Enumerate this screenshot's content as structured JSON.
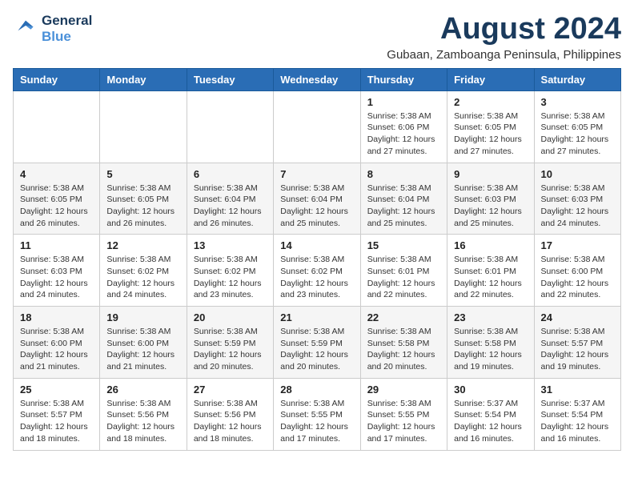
{
  "logo": {
    "line1": "General",
    "line2": "Blue"
  },
  "title": {
    "month_year": "August 2024",
    "location": "Gubaan, Zamboanga Peninsula, Philippines"
  },
  "headers": [
    "Sunday",
    "Monday",
    "Tuesday",
    "Wednesday",
    "Thursday",
    "Friday",
    "Saturday"
  ],
  "weeks": [
    [
      {
        "day": "",
        "info": ""
      },
      {
        "day": "",
        "info": ""
      },
      {
        "day": "",
        "info": ""
      },
      {
        "day": "",
        "info": ""
      },
      {
        "day": "1",
        "info": "Sunrise: 5:38 AM\nSunset: 6:06 PM\nDaylight: 12 hours\nand 27 minutes."
      },
      {
        "day": "2",
        "info": "Sunrise: 5:38 AM\nSunset: 6:05 PM\nDaylight: 12 hours\nand 27 minutes."
      },
      {
        "day": "3",
        "info": "Sunrise: 5:38 AM\nSunset: 6:05 PM\nDaylight: 12 hours\nand 27 minutes."
      }
    ],
    [
      {
        "day": "4",
        "info": "Sunrise: 5:38 AM\nSunset: 6:05 PM\nDaylight: 12 hours\nand 26 minutes."
      },
      {
        "day": "5",
        "info": "Sunrise: 5:38 AM\nSunset: 6:05 PM\nDaylight: 12 hours\nand 26 minutes."
      },
      {
        "day": "6",
        "info": "Sunrise: 5:38 AM\nSunset: 6:04 PM\nDaylight: 12 hours\nand 26 minutes."
      },
      {
        "day": "7",
        "info": "Sunrise: 5:38 AM\nSunset: 6:04 PM\nDaylight: 12 hours\nand 25 minutes."
      },
      {
        "day": "8",
        "info": "Sunrise: 5:38 AM\nSunset: 6:04 PM\nDaylight: 12 hours\nand 25 minutes."
      },
      {
        "day": "9",
        "info": "Sunrise: 5:38 AM\nSunset: 6:03 PM\nDaylight: 12 hours\nand 25 minutes."
      },
      {
        "day": "10",
        "info": "Sunrise: 5:38 AM\nSunset: 6:03 PM\nDaylight: 12 hours\nand 24 minutes."
      }
    ],
    [
      {
        "day": "11",
        "info": "Sunrise: 5:38 AM\nSunset: 6:03 PM\nDaylight: 12 hours\nand 24 minutes."
      },
      {
        "day": "12",
        "info": "Sunrise: 5:38 AM\nSunset: 6:02 PM\nDaylight: 12 hours\nand 24 minutes."
      },
      {
        "day": "13",
        "info": "Sunrise: 5:38 AM\nSunset: 6:02 PM\nDaylight: 12 hours\nand 23 minutes."
      },
      {
        "day": "14",
        "info": "Sunrise: 5:38 AM\nSunset: 6:02 PM\nDaylight: 12 hours\nand 23 minutes."
      },
      {
        "day": "15",
        "info": "Sunrise: 5:38 AM\nSunset: 6:01 PM\nDaylight: 12 hours\nand 22 minutes."
      },
      {
        "day": "16",
        "info": "Sunrise: 5:38 AM\nSunset: 6:01 PM\nDaylight: 12 hours\nand 22 minutes."
      },
      {
        "day": "17",
        "info": "Sunrise: 5:38 AM\nSunset: 6:00 PM\nDaylight: 12 hours\nand 22 minutes."
      }
    ],
    [
      {
        "day": "18",
        "info": "Sunrise: 5:38 AM\nSunset: 6:00 PM\nDaylight: 12 hours\nand 21 minutes."
      },
      {
        "day": "19",
        "info": "Sunrise: 5:38 AM\nSunset: 6:00 PM\nDaylight: 12 hours\nand 21 minutes."
      },
      {
        "day": "20",
        "info": "Sunrise: 5:38 AM\nSunset: 5:59 PM\nDaylight: 12 hours\nand 20 minutes."
      },
      {
        "day": "21",
        "info": "Sunrise: 5:38 AM\nSunset: 5:59 PM\nDaylight: 12 hours\nand 20 minutes."
      },
      {
        "day": "22",
        "info": "Sunrise: 5:38 AM\nSunset: 5:58 PM\nDaylight: 12 hours\nand 20 minutes."
      },
      {
        "day": "23",
        "info": "Sunrise: 5:38 AM\nSunset: 5:58 PM\nDaylight: 12 hours\nand 19 minutes."
      },
      {
        "day": "24",
        "info": "Sunrise: 5:38 AM\nSunset: 5:57 PM\nDaylight: 12 hours\nand 19 minutes."
      }
    ],
    [
      {
        "day": "25",
        "info": "Sunrise: 5:38 AM\nSunset: 5:57 PM\nDaylight: 12 hours\nand 18 minutes."
      },
      {
        "day": "26",
        "info": "Sunrise: 5:38 AM\nSunset: 5:56 PM\nDaylight: 12 hours\nand 18 minutes."
      },
      {
        "day": "27",
        "info": "Sunrise: 5:38 AM\nSunset: 5:56 PM\nDaylight: 12 hours\nand 18 minutes."
      },
      {
        "day": "28",
        "info": "Sunrise: 5:38 AM\nSunset: 5:55 PM\nDaylight: 12 hours\nand 17 minutes."
      },
      {
        "day": "29",
        "info": "Sunrise: 5:38 AM\nSunset: 5:55 PM\nDaylight: 12 hours\nand 17 minutes."
      },
      {
        "day": "30",
        "info": "Sunrise: 5:37 AM\nSunset: 5:54 PM\nDaylight: 12 hours\nand 16 minutes."
      },
      {
        "day": "31",
        "info": "Sunrise: 5:37 AM\nSunset: 5:54 PM\nDaylight: 12 hours\nand 16 minutes."
      }
    ]
  ]
}
